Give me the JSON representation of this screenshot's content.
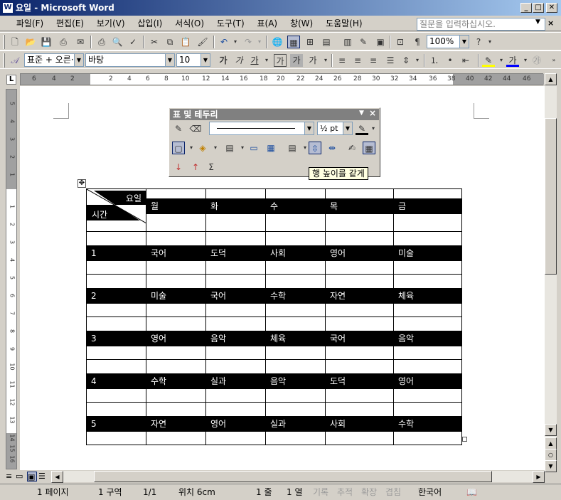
{
  "window": {
    "title": "요일 - Microsoft Word",
    "app_icon": "W"
  },
  "menu": {
    "items": [
      "파일(F)",
      "편집(E)",
      "보기(V)",
      "삽입(I)",
      "서식(O)",
      "도구(T)",
      "표(A)",
      "창(W)",
      "도움말(H)"
    ],
    "help_placeholder": "질문을 입력하십시오."
  },
  "standard_toolbar": {
    "zoom": "100%"
  },
  "format_toolbar": {
    "style": "표준 + 오른·",
    "font": "바탕",
    "size": "10",
    "buttons": {
      "bold": "가",
      "italic": "가",
      "underline": "가",
      "char_border": "가",
      "char_shade": "가",
      "char_scale": "가",
      "font_color": "가"
    }
  },
  "ruler": {
    "tab_marker": "L",
    "numbers": [
      "6",
      "4",
      "2",
      "2",
      "4",
      "6",
      "8",
      "10",
      "12",
      "14",
      "16",
      "18",
      "20",
      "22",
      "24",
      "26",
      "28",
      "30",
      "32",
      "34",
      "36",
      "38",
      "40",
      "42",
      "44",
      "46"
    ]
  },
  "vruler": {
    "numbers": [
      "5",
      "4",
      "3",
      "2",
      "1",
      "1",
      "2",
      "3",
      "4",
      "5",
      "6",
      "7",
      "8",
      "9",
      "10",
      "11",
      "12",
      "13",
      "14",
      "15",
      "16"
    ]
  },
  "table_toolbar": {
    "title": "표 및 테두리",
    "line_weight": "½ pt",
    "autosum": "Σ"
  },
  "tooltip": "행 높이를 같게",
  "timetable": {
    "header_top": "요일",
    "header_bottom": "시간",
    "days": [
      "월",
      "화",
      "수",
      "목",
      "금"
    ],
    "rows": [
      {
        "period": "1",
        "subjects": [
          "국어",
          "도덕",
          "사회",
          "영어",
          "미술"
        ]
      },
      {
        "period": "2",
        "subjects": [
          "미술",
          "국어",
          "수학",
          "자연",
          "체육"
        ]
      },
      {
        "period": "3",
        "subjects": [
          "영어",
          "음악",
          "체육",
          "국어",
          "음악"
        ]
      },
      {
        "period": "4",
        "subjects": [
          "수학",
          "실과",
          "음악",
          "도덕",
          "영어"
        ]
      },
      {
        "period": "5",
        "subjects": [
          "자연",
          "영어",
          "실과",
          "사회",
          "수학"
        ]
      }
    ]
  },
  "status": {
    "page": "1 페이지",
    "section": "1 구역",
    "pages": "1/1",
    "position": "위치 6cm",
    "line": "1 줄",
    "column": "1 열",
    "rec": "기록",
    "trk": "추적",
    "ext": "확장",
    "ovr": "겹침",
    "lang": "한국어"
  }
}
